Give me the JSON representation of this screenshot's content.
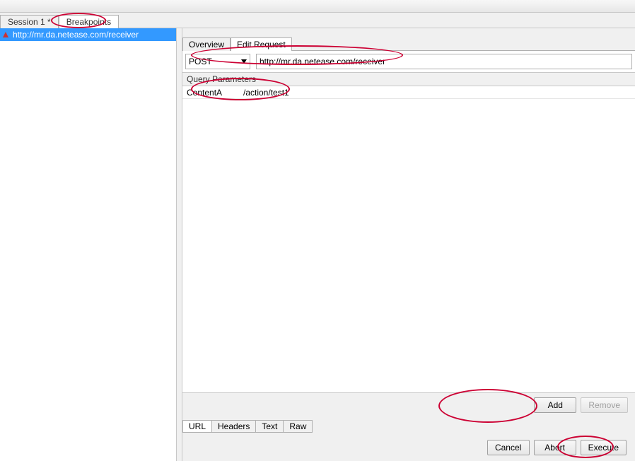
{
  "mainTabs": {
    "session": "Session 1 *",
    "breakpoints": "Breakpoints"
  },
  "leftList": {
    "items": [
      {
        "url": "http://mr.da.netease.com/receiver"
      }
    ]
  },
  "subTabs": {
    "overview": "Overview",
    "editRequest": "Edit Request"
  },
  "method": {
    "selected": "POST"
  },
  "url": {
    "value": "http://mr.da.netease.com/receiver"
  },
  "sectionHeader": "Query Parameters",
  "params": [
    {
      "name": "ContentA",
      "value": "/action/test1"
    }
  ],
  "buttons": {
    "add": "Add",
    "remove": "Remove",
    "cancel": "Cancel",
    "abort": "Abort",
    "execute": "Execute"
  },
  "bottomTabs": {
    "url": "URL",
    "headers": "Headers",
    "text": "Text",
    "raw": "Raw"
  }
}
